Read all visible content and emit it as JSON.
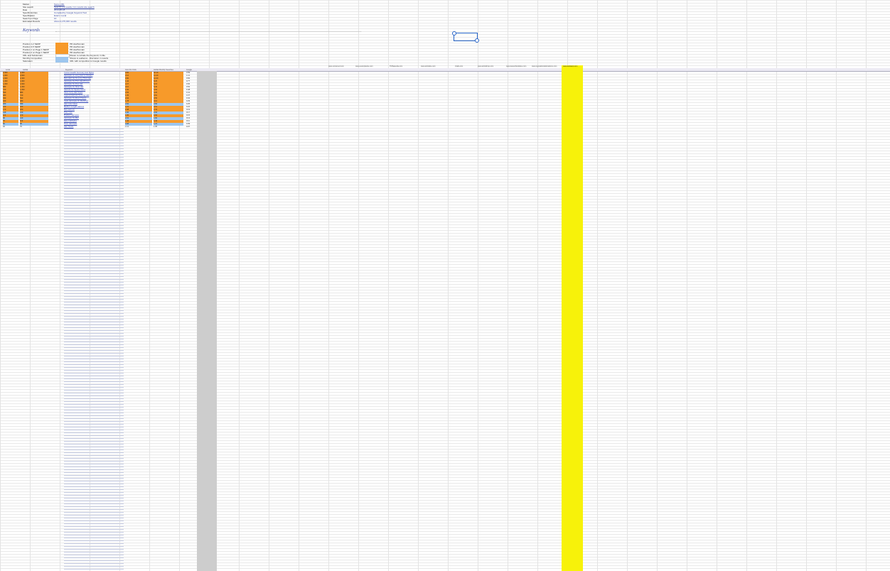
{
  "sheet": {
    "info_rows": [
      {
        "key": "Market",
        "value": "Some URL"
      },
      {
        "key": "Site search",
        "value": "Search 1 of results / 2.1 results site search"
      },
      {
        "key": "Date",
        "value": "2014-05-18"
      },
      {
        "key": "Specific Entries",
        "value": "Compiled by Google Keyword Tool"
      },
      {
        "key": "Specification",
        "value": "Exact / Local"
      },
      {
        "key": "Search on Page",
        "value": "10"
      },
      {
        "key": "Estimated Results",
        "value": "About 4,270,000 results"
      }
    ],
    "keywords_title": "Keywords",
    "legend": [
      {
        "key": "Position 1-2 SERP",
        "color": "#f79a2a",
        "text": "PR site/Domain"
      },
      {
        "key": "Position 3-5 SERP",
        "color": "#f79a2a",
        "text": "PR site/Domain"
      },
      {
        "key": "Position 1 on Page 1 SERP",
        "color": "#f79a2a",
        "text": "PR site/Domain"
      },
      {
        "key": "Position 2 on Page 1 SERP",
        "color": "#f79a2a",
        "text": "PR site/Domain"
      },
      {
        "key": "URL and Subdomain",
        "color": "#ffffff",
        "text": "Shown to include the Keyword, in title"
      },
      {
        "key": "Monthly Competition",
        "color": "#9dc6ee",
        "text": "Shows to audience - Discretion in results"
      },
      {
        "key": "Saturation",
        "color": "#9dc6ee",
        "text": "URL with competition to Google results"
      }
    ],
    "column_headers": {
      "a": "Local",
      "b": "Global",
      "c": "Keyword",
      "d": "Cost Per Click",
      "e": "Global Monthly Searches",
      "f": "Google",
      "yellow": "www.ambient.com",
      "sites": [
        "www.unnamed.com",
        "www.examplesite.com",
        "TMSapedia.com",
        "www.artistsite.com",
        "chalk.com",
        "www.artistshop.com",
        "www.teasurfandsites.com",
        "www.reputationaldonations.com"
      ]
    },
    "rows": [
      {
        "a": "2,400",
        "b": "4,400",
        "c": "Current Health Summary Hair Styles",
        "d": "4.82",
        "e": "22.10",
        "f": "0.59",
        "fill": "orange"
      },
      {
        "a": "1,900",
        "b": "2,900",
        "c": "Hairstyles on Long Hair for Women",
        "d": "2.16",
        "e": "14.40",
        "f": "1.12",
        "fill": "orange"
      },
      {
        "a": "1,600",
        "b": "2,400",
        "c": "Best Haircuts for Long Thick Hair",
        "d": "3.90",
        "e": "12.60",
        "f": "0.84",
        "fill": "orange"
      },
      {
        "a": "1,300",
        "b": "1,900",
        "c": "Hairstyles for Thin Hair Women",
        "d": "1.44",
        "e": "8.25",
        "f": "0.77",
        "fill": "orange"
      },
      {
        "a": "1,000",
        "b": "1,600",
        "c": "Hairstyles for Fine Hair",
        "d": "2.27",
        "e": "6.15",
        "f": "0.66",
        "fill": "orange"
      },
      {
        "a": "880",
        "b": "1,300",
        "c": "Hairstyles for Short Hair",
        "d": "3.10",
        "e": "5.40",
        "f": "0.52",
        "fill": "orange"
      },
      {
        "a": "720",
        "b": "1,000",
        "c": "Haircuts for Square Faces",
        "d": "1.92",
        "e": "4.92",
        "f": "0.48",
        "fill": "orange"
      },
      {
        "a": "590",
        "b": "880",
        "c": "Short Curly Hair Styles",
        "d": "2.65",
        "e": "4.20",
        "f": "0.41",
        "fill": "orange"
      },
      {
        "a": "480",
        "b": "720",
        "c": "Layered Haircuts for Long Hair",
        "d": "1.35",
        "e": "3.81",
        "f": "0.37",
        "fill": "orange"
      },
      {
        "a": "390",
        "b": "590",
        "c": "Hairstyles for Round Faces",
        "d": "2.04",
        "e": "3.55",
        "f": "0.32",
        "fill": "orange"
      },
      {
        "a": "320",
        "b": "480",
        "c": "Updo Hairstyles for Weddings",
        "d": "1.78",
        "e": "3.10",
        "f": "0.29",
        "fill": "orange"
      },
      {
        "a": "260",
        "b": "390",
        "c": "Hair Color Ideas",
        "d": "2.92",
        "e": "2.84",
        "f": "0.25",
        "fill": "blue"
      },
      {
        "a": "210",
        "b": "320",
        "c": "Medium Length Haircuts",
        "d": "1.21",
        "e": "2.61",
        "f": "0.22",
        "fill": "orange"
      },
      {
        "a": "170",
        "b": "260",
        "c": "Bob Haircuts",
        "d": "2.48",
        "e": "2.33",
        "f": "0.19",
        "fill": "orange"
      },
      {
        "a": "140",
        "b": "210",
        "c": "Pixie Cuts",
        "d": "1.66",
        "e": "2.02",
        "f": "0.17",
        "fill": "blue"
      },
      {
        "a": "110",
        "b": "170",
        "c": "Braided Hairstyles",
        "d": "1.05",
        "e": "1.84",
        "f": "0.15",
        "fill": "orange"
      },
      {
        "a": "90",
        "b": "140",
        "c": "Hairstyles for Men",
        "d": "2.31",
        "e": "1.60",
        "f": "0.13",
        "fill": "blue"
      },
      {
        "a": "70",
        "b": "110",
        "c": "Easy Hairstyles",
        "d": "1.44",
        "e": "1.42",
        "f": "0.11",
        "fill": "orange"
      },
      {
        "a": "50",
        "b": "90",
        "c": "Prom Hairstyles",
        "d": "0.98",
        "e": "1.21",
        "f": "0.09",
        "fill": "blue"
      },
      {
        "a": "40",
        "b": "70",
        "c": "Hair Trends",
        "d": "1.12",
        "e": "1.05",
        "f": "0.07",
        "fill": "none"
      }
    ]
  }
}
